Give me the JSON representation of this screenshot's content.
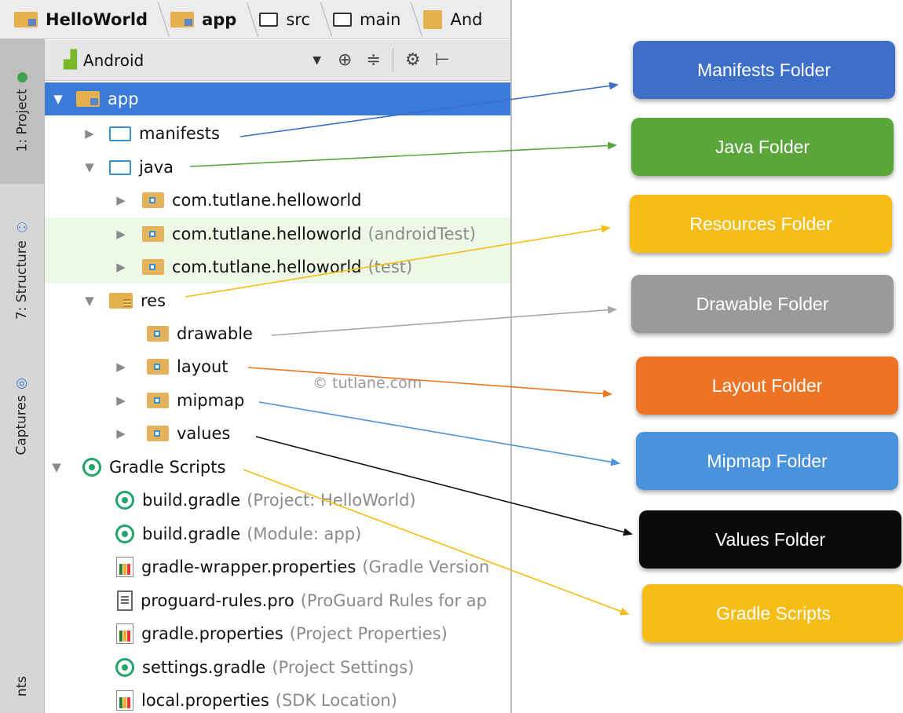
{
  "breadcrumb": {
    "items": [
      {
        "label": "HelloWorld",
        "bold": true,
        "icon": "module-folder-icon"
      },
      {
        "label": "app",
        "bold": true,
        "icon": "module-folder-icon"
      },
      {
        "label": "src",
        "bold": false,
        "icon": "folder-icon"
      },
      {
        "label": "main",
        "bold": false,
        "icon": "folder-icon"
      },
      {
        "label": "And",
        "bold": false,
        "icon": "manifest-file-icon"
      }
    ]
  },
  "side_tabs": {
    "project": "1: Project",
    "structure": "7: Structure",
    "captures": "Captures",
    "bottom": "nts"
  },
  "toolbar": {
    "view_mode": "Android",
    "icons": [
      "target-icon",
      "collapse-icon",
      "gear-icon",
      "hide-icon"
    ]
  },
  "tree": {
    "app": {
      "label": "app"
    },
    "manifests": {
      "label": "manifests"
    },
    "java": {
      "label": "java"
    },
    "pkg_main": {
      "label": "com.tutlane.helloworld",
      "hint": ""
    },
    "pkg_android_test": {
      "label": "com.tutlane.helloworld",
      "hint": "(androidTest)"
    },
    "pkg_test": {
      "label": "com.tutlane.helloworld",
      "hint": "(test)"
    },
    "res": {
      "label": "res"
    },
    "drawable": {
      "label": "drawable"
    },
    "layout": {
      "label": "layout"
    },
    "mipmap": {
      "label": "mipmap"
    },
    "values": {
      "label": "values"
    },
    "gradle_scripts": {
      "label": "Gradle Scripts"
    },
    "build_gradle_project": {
      "label": "build.gradle",
      "hint": "(Project: HelloWorld)"
    },
    "build_gradle_module": {
      "label": "build.gradle",
      "hint": "(Module: app)"
    },
    "gradle_wrapper": {
      "label": "gradle-wrapper.properties",
      "hint": "(Gradle Version"
    },
    "proguard": {
      "label": "proguard-rules.pro",
      "hint": "(ProGuard Rules for ap"
    },
    "gradle_properties": {
      "label": "gradle.properties",
      "hint": "(Project Properties)"
    },
    "settings_gradle": {
      "label": "settings.gradle",
      "hint": "(Project Settings)"
    },
    "local_properties": {
      "label": "local.properties",
      "hint": "(SDK Location)"
    }
  },
  "watermark": "© tutlane.com",
  "callouts": {
    "manifests": {
      "label": "Manifests Folder",
      "color": "#3d6fc9",
      "line": "#3d6fc9"
    },
    "java": {
      "label": "Java Folder",
      "color": "#5aa63a",
      "line": "#5aa63a"
    },
    "resources": {
      "label": "Resources Folder",
      "color": "#f5bd16",
      "line": "#f5bd16"
    },
    "drawable": {
      "label": "Drawable Folder",
      "color": "#9a9a9a",
      "line": "#a8a8a8"
    },
    "layout": {
      "label": "Layout Folder",
      "color": "#ec7424",
      "line": "#ec7424"
    },
    "mipmap": {
      "label": "Mipmap Folder",
      "color": "#4b92dc",
      "line": "#4b92dc"
    },
    "values": {
      "label": "Values Folder",
      "color": "#0a0a0a",
      "line": "#111111"
    },
    "gradle": {
      "label": "Gradle Scripts",
      "color": "#f5bd16",
      "line": "#f5bd16"
    }
  },
  "colors": {
    "selection": "#3a7ad8",
    "test_rows": "#eef8e6"
  }
}
